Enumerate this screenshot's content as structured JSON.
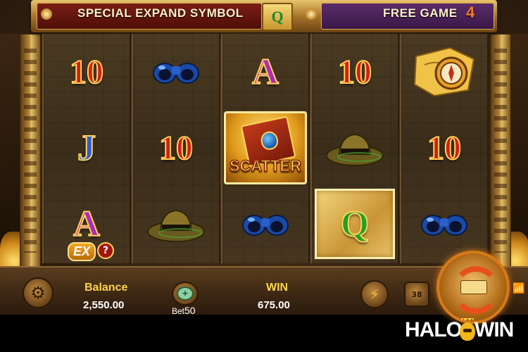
{
  "banner": {
    "special_label": "SPECIAL EXPAND SYMBOL",
    "special_symbol": "Q",
    "free_label": "FREE GAME",
    "free_count": "4"
  },
  "reels": [
    [
      "10",
      "J",
      "A"
    ],
    [
      "binoculars",
      "10",
      "hat"
    ],
    [
      "A",
      "SCATTER",
      "binoculars"
    ],
    [
      "10",
      "hat",
      "Q"
    ],
    [
      "map-compass",
      "10",
      "binoculars"
    ]
  ],
  "symbols": {
    "scatter_label": "SCATTER",
    "ex_label": "EX",
    "ex_help": "?"
  },
  "controls": {
    "balance_label": "Balance",
    "balance_value": "2,550.00",
    "bet_label": "Bet",
    "bet_value": "50",
    "win_label": "WIN",
    "win_value": "675.00",
    "auto_count": "38"
  },
  "watermark": {
    "part1": "HALO",
    "part2": "WIN"
  },
  "colors": {
    "accent_gold": "#ffd24a",
    "spin_orange": "#e8501a",
    "free_count": "#ff7a2a"
  }
}
